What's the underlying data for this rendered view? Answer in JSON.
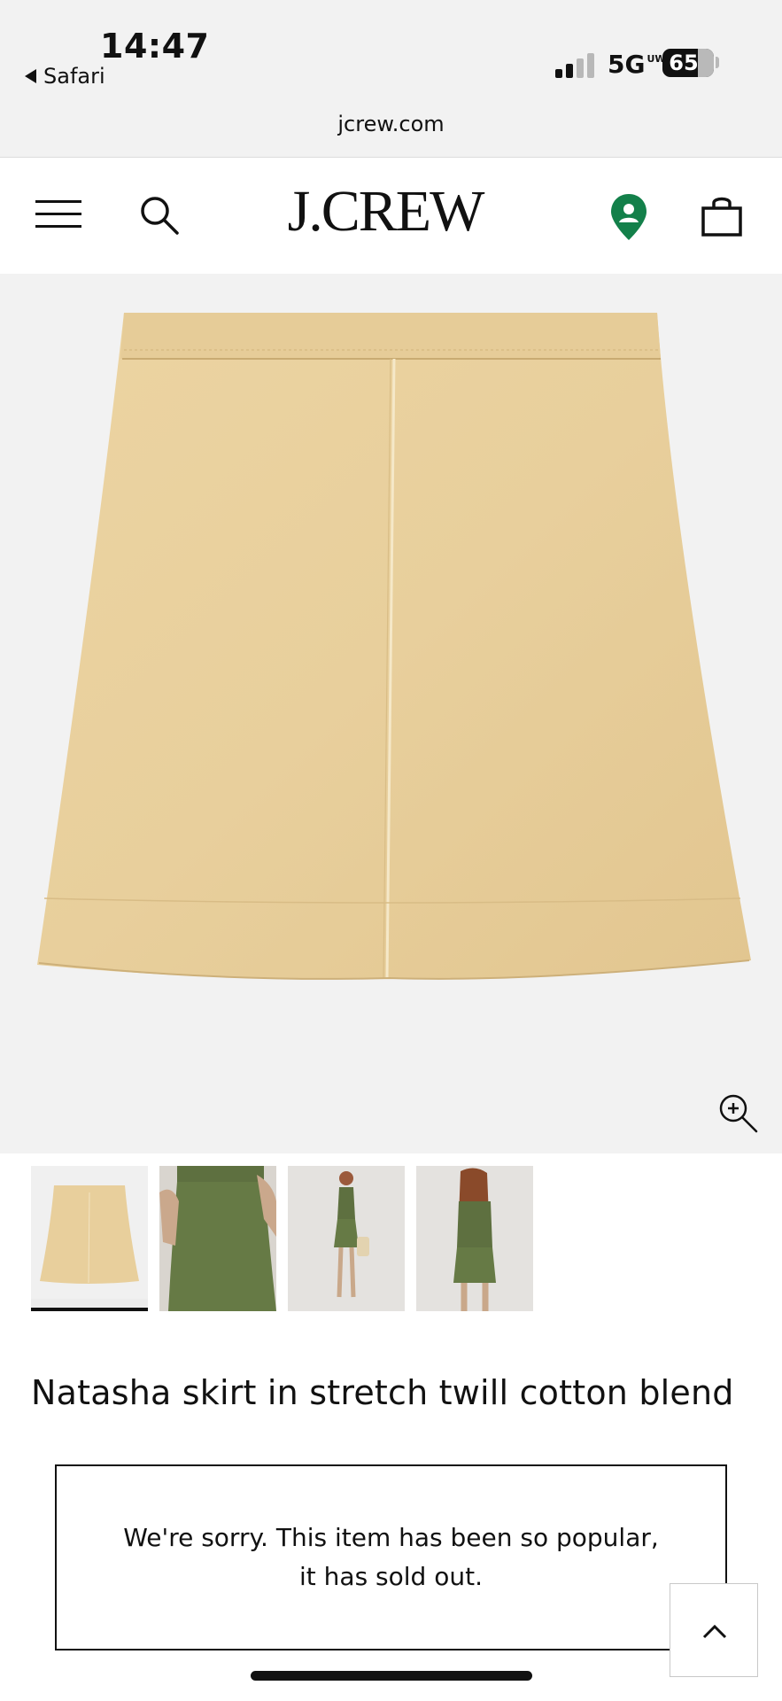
{
  "status_bar": {
    "time": "14:47",
    "back_app": "Safari",
    "network": "5G",
    "network_badge": "UW",
    "battery": "65",
    "url": "jcrew.com"
  },
  "header": {
    "logo": "J.CREW",
    "icons": [
      "menu-icon",
      "search-icon",
      "location-icon",
      "shopping-bag-icon"
    ],
    "location_icon_color": "#13804a"
  },
  "product": {
    "title": "Natasha skirt in stretch twill cotton blend",
    "image_color": "#e8cf9c",
    "thumbnail_count": 4,
    "selected_thumbnail": 1,
    "soldout_line1": "We're sorry. This item has been so popular,",
    "soldout_line2": "it has sold out."
  },
  "colors": {
    "khaki": "#e8cf9c",
    "olive": "#667a45"
  }
}
